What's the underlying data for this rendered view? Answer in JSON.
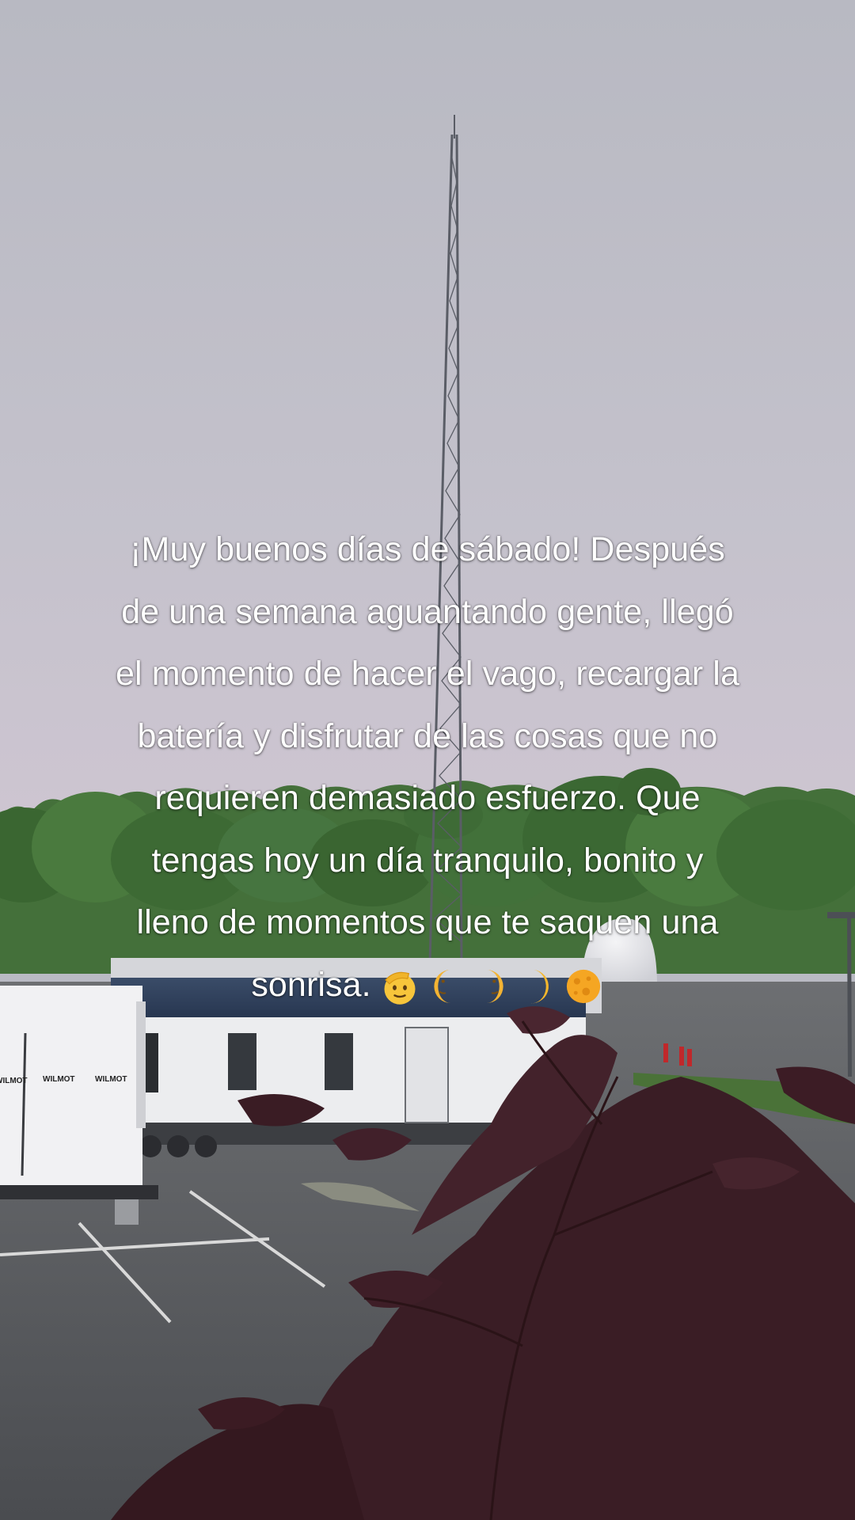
{
  "caption": {
    "lines": [
      "¡Muy buenos días de sábado! Después",
      "de una semana aguantando gente, llegó",
      "el momento de hacer el vago, recargar la",
      "batería y disfrutar de las cosas que no",
      "requieren demasiado esfuerzo. Que",
      "tengas hoy un día tranquilo, bonito y",
      "lleno de momentos que te saquen una",
      "sonrisa."
    ],
    "emojis": [
      "saluting-face",
      "moon-face",
      "moon-face",
      "crescent-moon",
      "full-moon"
    ]
  },
  "photo": {
    "signs": {
      "trailer_brand_left": "WILMOT",
      "trailer_brand_right": "WILMOT",
      "trailer_brand_edge": "WILMOT"
    }
  },
  "colors": {
    "caption_text": "#ffffff",
    "sky_top": "#b9bac3",
    "sky_bottom": "#cbc3cf",
    "foliage": "#3e6a34",
    "asphalt": "#5d5f63",
    "trailer_roof": "#2e3f5a",
    "maple_leaves": "#3a1c24"
  }
}
